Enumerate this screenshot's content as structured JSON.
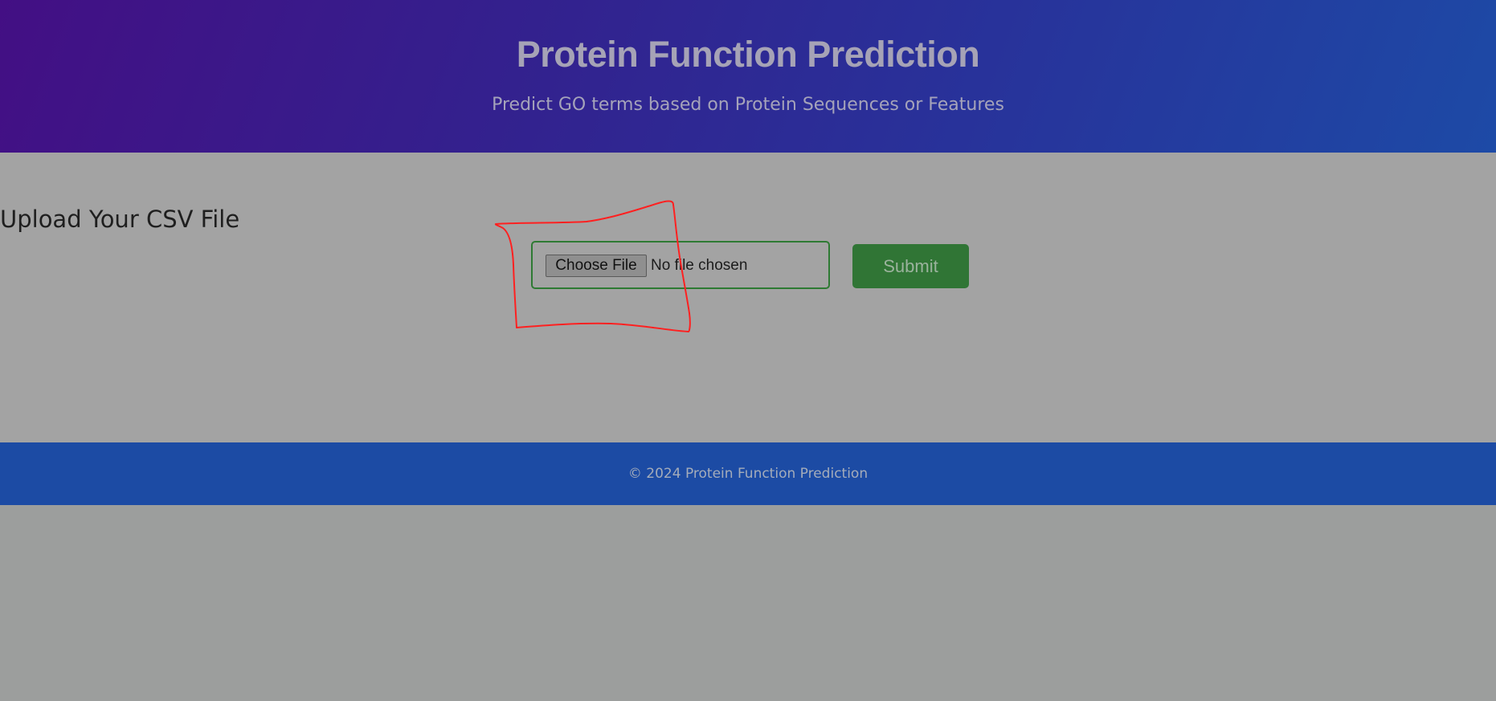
{
  "header": {
    "title": "Protein Function Prediction",
    "subtitle": "Predict GO terms based on Protein Sequences or Features"
  },
  "upload": {
    "title": "Upload Your CSV File",
    "choose_label": "Choose File",
    "file_status": "No file chosen",
    "submit_label": "Submit"
  },
  "footer": {
    "text": "© 2024 Protein Function Prediction"
  },
  "colors": {
    "header_gradient_start": "#430f84",
    "header_gradient_end": "#1d4aa6",
    "submit": "#307535",
    "footer": "#1c4ba4",
    "annotation": "#ff2020"
  }
}
